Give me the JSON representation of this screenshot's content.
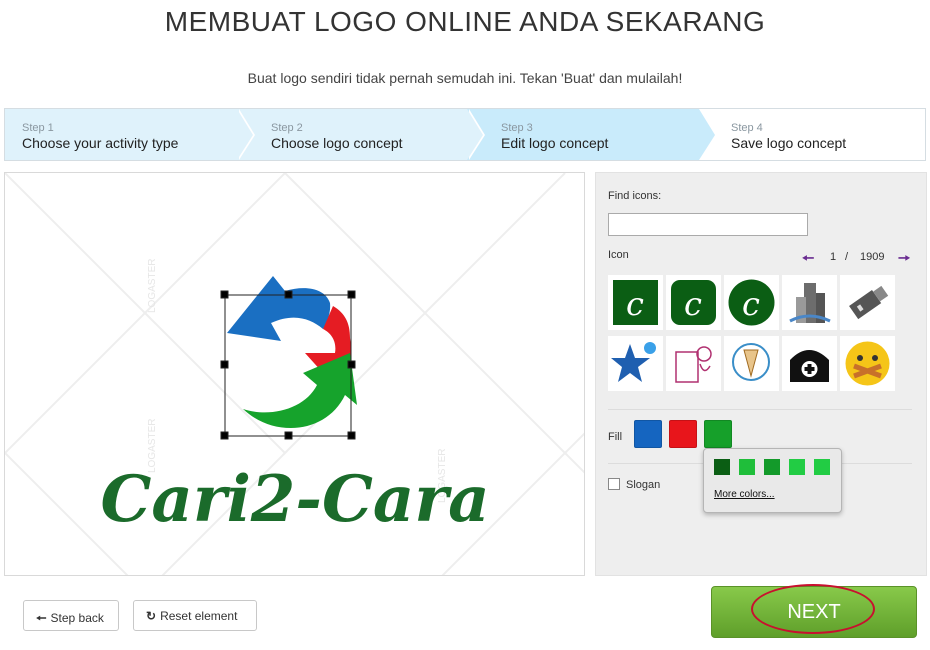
{
  "header": {
    "title": "MEMBUAT LOGO ONLINE ANDA SEKARANG",
    "subtitle": "Buat logo sendiri tidak pernah semudah ini. Tekan 'Buat' dan mulailah!"
  },
  "steps": [
    {
      "num": "Step 1",
      "label": "Choose your activity type"
    },
    {
      "num": "Step 2",
      "label": "Choose logo concept"
    },
    {
      "num": "Step 3",
      "label": "Edit logo concept"
    },
    {
      "num": "Step 4",
      "label": "Save logo concept"
    }
  ],
  "canvas": {
    "logo_text": "Cari2-Cara",
    "watermark": "LOGASTER"
  },
  "panel": {
    "find_label": "Find icons:",
    "find_value": "",
    "icon_label": "Icon",
    "pager": {
      "current": "1",
      "separator": "/",
      "total": "1909"
    },
    "fill_label": "Fill",
    "fill_colors": [
      "#1565c0",
      "#e8151b",
      "#16a02a"
    ],
    "slogan_label": "Slogan"
  },
  "popup": {
    "colors": [
      "#0b5e14",
      "#1fbe3a",
      "#139a2a",
      "#22cc44",
      "#22cc44"
    ],
    "more_label": "More colors..."
  },
  "actions": {
    "step_back": "Step back",
    "reset": "Reset element",
    "next": "NEXT"
  }
}
